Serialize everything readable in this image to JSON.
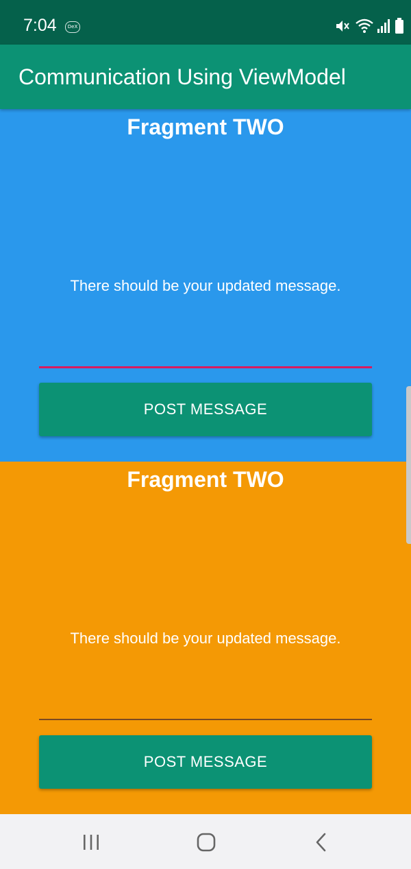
{
  "status_bar": {
    "time": "7:04",
    "dex_badge": "DeX",
    "icons": [
      "mute-icon",
      "wifi-icon",
      "signal-icon",
      "battery-icon"
    ]
  },
  "app_bar": {
    "title": "Communication Using ViewModel"
  },
  "fragments": [
    {
      "title": "Fragment TWO",
      "message": "There should be your updated message.",
      "input_value": "",
      "button_label": "POST MESSAGE",
      "background": "#2a98ec"
    },
    {
      "title": "Fragment TWO",
      "message": "There should be your updated message.",
      "input_value": "",
      "button_label": "POST MESSAGE",
      "background": "#f49905"
    }
  ],
  "nav_bar": {
    "buttons": [
      "recents-icon",
      "home-icon",
      "back-icon"
    ]
  },
  "colors": {
    "status_bar": "#05614b",
    "app_bar": "#0c9274",
    "button": "#0c9274",
    "input_underline_active": "#d81b60"
  }
}
